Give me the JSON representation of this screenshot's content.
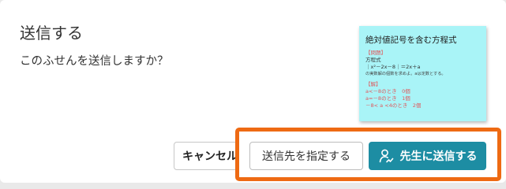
{
  "dialog": {
    "title": "送信する",
    "message": "このふせんを送信しますか？"
  },
  "card": {
    "title": "絶対値記号を含む方程式",
    "tag": "【問題】",
    "label": "方程式",
    "equation": "｜x²－2x－8｜＝2x＋a",
    "note": "の実数解の個数を求めよ。aは定数とする。",
    "answer_tag": "【解】",
    "answers": [
      "a<－8のとき　0個",
      "a=－8のとき　1個",
      "－8< a <4のとき　2個"
    ],
    "colors": {
      "background": "#a9f4f7",
      "accent": "#e0585c"
    }
  },
  "buttons": {
    "cancel_label": "キャンセル",
    "assign_label": "送信先を指定する",
    "send_label": "先生に送信する",
    "send_icon": "teacher-person-icon"
  },
  "colors": {
    "primary": "#1d8da3",
    "highlight": "#ee6a13"
  }
}
